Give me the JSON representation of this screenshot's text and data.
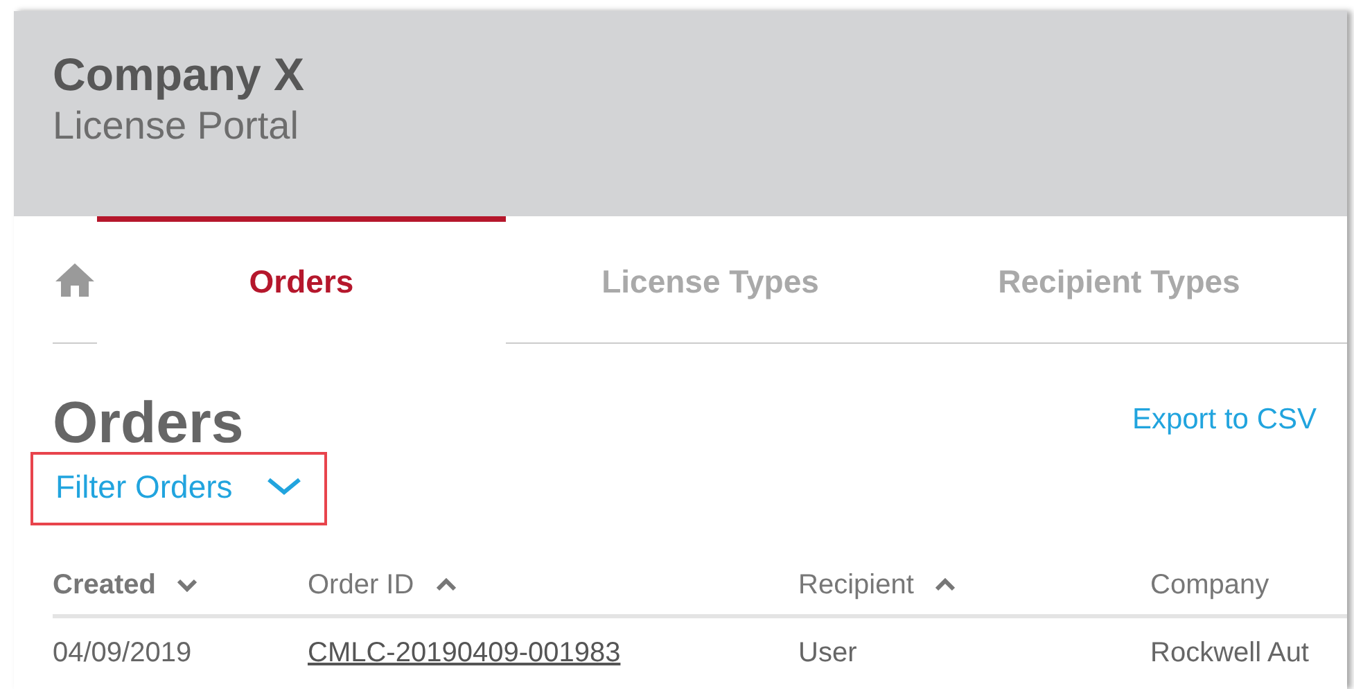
{
  "header": {
    "title": "Company X",
    "subtitle": "License Portal"
  },
  "tabs": [
    {
      "label": "Orders",
      "selected": true
    },
    {
      "label": "License Types",
      "selected": false
    },
    {
      "label": "Recipient Types",
      "selected": false
    }
  ],
  "page_title": "Orders",
  "export_link": "Export to CSV",
  "filter": {
    "label": "Filter Orders",
    "expanded": false,
    "highlighted": true
  },
  "table": {
    "columns": [
      {
        "label": "Created",
        "sortable": true,
        "descending": true,
        "active": true
      },
      {
        "label": "Order ID",
        "sortable": true,
        "descending": false,
        "active": false
      },
      {
        "label": "Recipient",
        "sortable": true,
        "descending": false,
        "active": false
      },
      {
        "label": "Company",
        "sortable": false,
        "active": false
      }
    ],
    "rows": [
      {
        "created": "04/09/2019",
        "order_id": "CMLC-20190409-001983",
        "recipient": "User",
        "company": "Rockwell Aut"
      }
    ]
  }
}
